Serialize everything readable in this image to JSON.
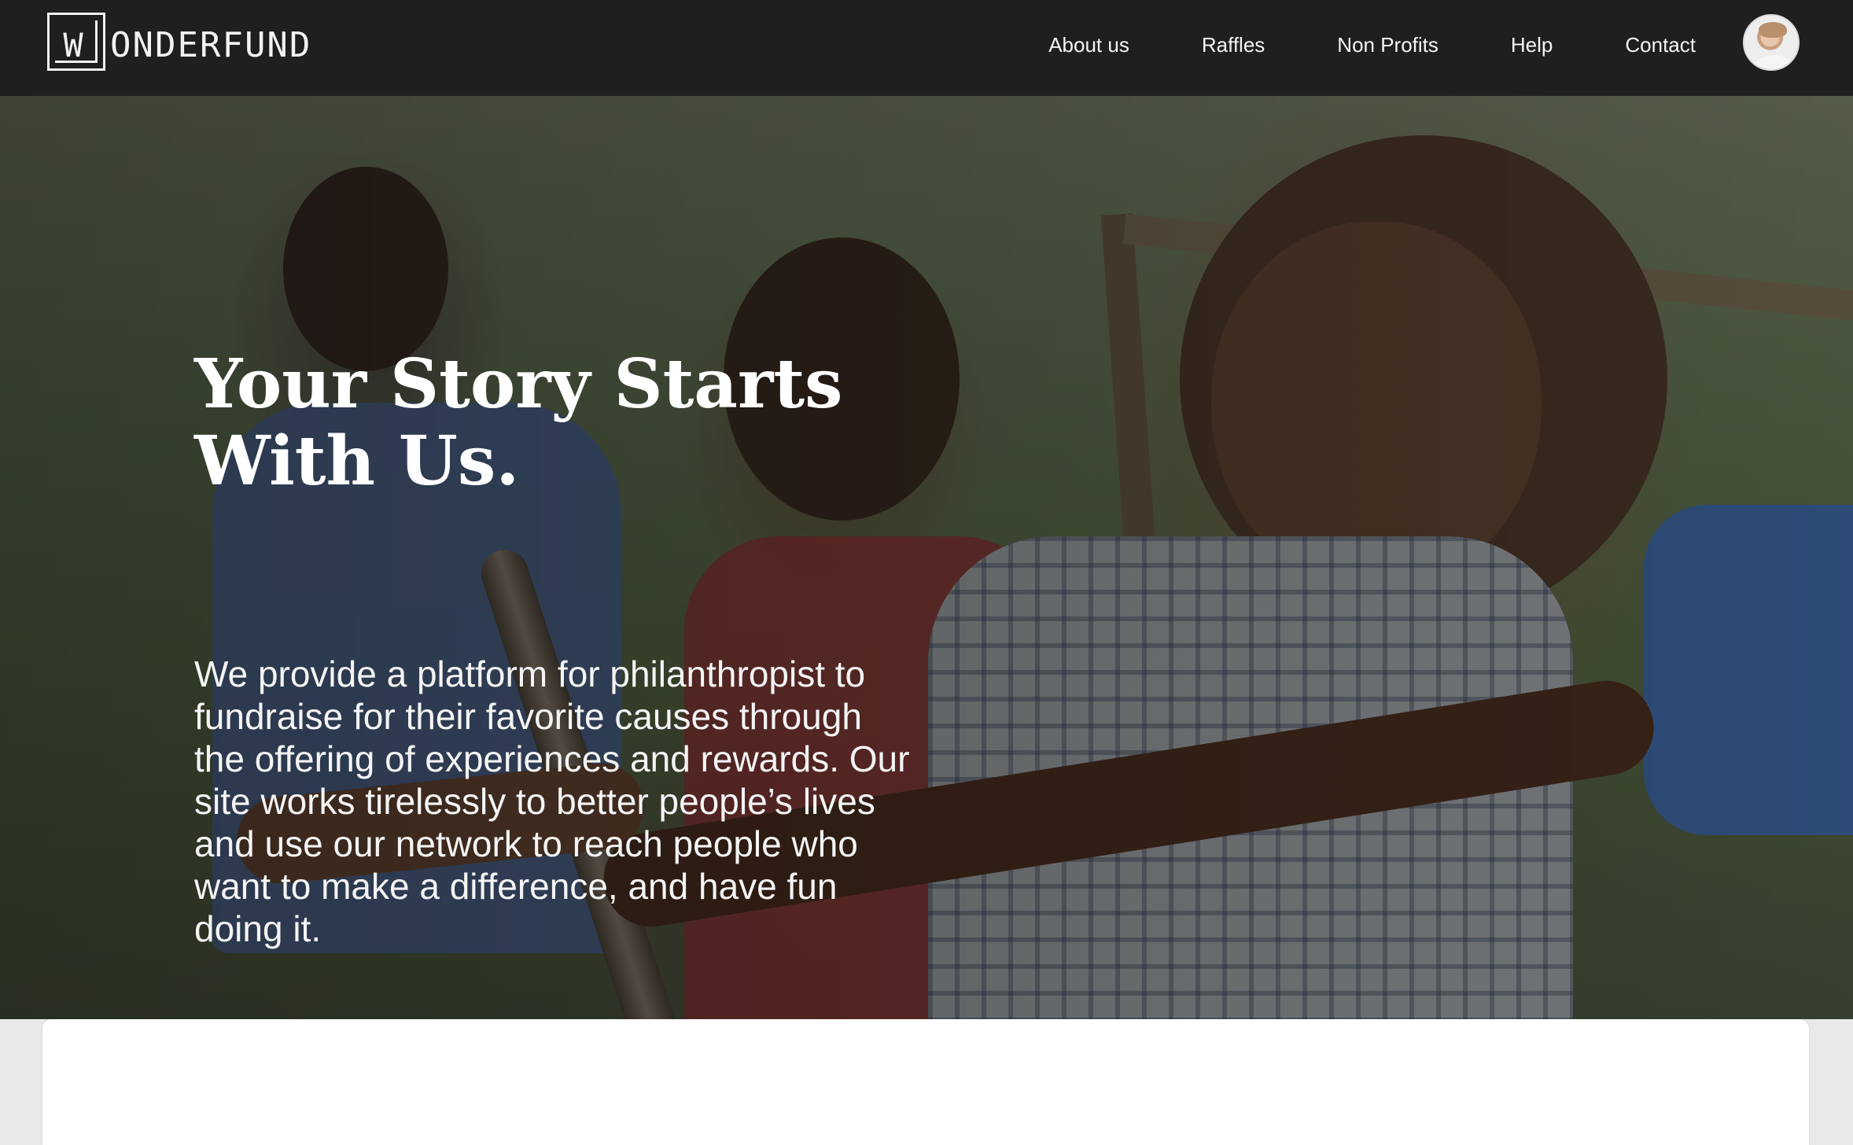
{
  "brand": {
    "logo_letter": "W",
    "logo_text": "ONDERFUND"
  },
  "nav": {
    "items": [
      {
        "label": "About us"
      },
      {
        "label": "Raffles"
      },
      {
        "label": "Non Profits"
      },
      {
        "label": "Help"
      },
      {
        "label": "Contact"
      }
    ],
    "avatar_icon": "user-avatar"
  },
  "hero": {
    "title": "Your Story Starts With Us.",
    "description": "We provide a platform for philanthropist to fundraise for their favorite causes through the offering of experiences and rewards. Our site works tirelessly to better people’s lives and use our network to reach people who want to make a difference, and have fun doing it."
  },
  "colors": {
    "navbar_bg": "#1f1f1f",
    "nav_text": "#f4f4f4",
    "hero_text": "#ffffff",
    "card_bg": "#ffffff"
  }
}
